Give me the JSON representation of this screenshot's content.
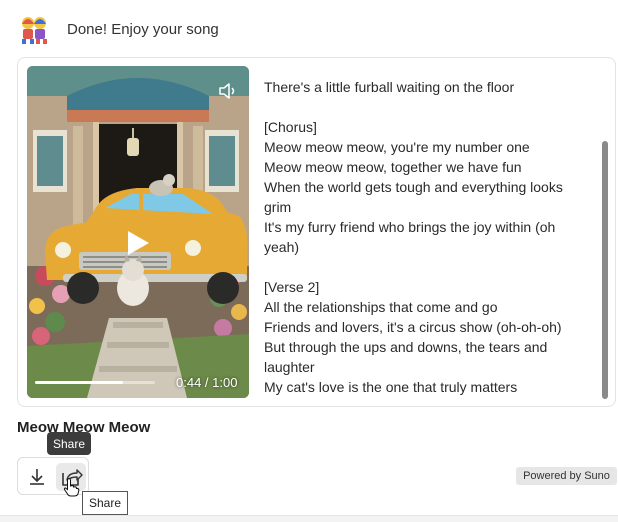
{
  "header": {
    "message": "Done! Enjoy your song",
    "avatar_icon": "bot-emoji-avatar-icon"
  },
  "player": {
    "current_time": "0:44",
    "duration": "1:00",
    "time_display": "0:44 / 1:00",
    "progress_fraction": 0.73,
    "mute_icon": "speaker-icon",
    "play_icon": "play-icon"
  },
  "lyrics": [
    "There's a little furball waiting on the floor",
    "",
    "[Chorus]",
    "Meow meow meow, you're my number one",
    "Meow meow meow, together we have fun",
    "When the world gets tough and everything looks",
    "grim",
    "It's my furry friend who brings the joy within (oh",
    "yeah)",
    "",
    "[Verse 2]",
    "All the relationships that come and go",
    "Friends and lovers, it's a circus show (oh-oh-oh)",
    "But through the ups and downs, the tears and",
    "laughter",
    "My cat's love is the one that truly matters"
  ],
  "song": {
    "title": "Meow Meow Meow"
  },
  "actions": {
    "download_icon": "download-icon",
    "share_icon": "share-icon",
    "share_tooltip": "Share",
    "share_title_tooltip": "Share"
  },
  "footer": {
    "powered_by": "Powered by Suno"
  }
}
